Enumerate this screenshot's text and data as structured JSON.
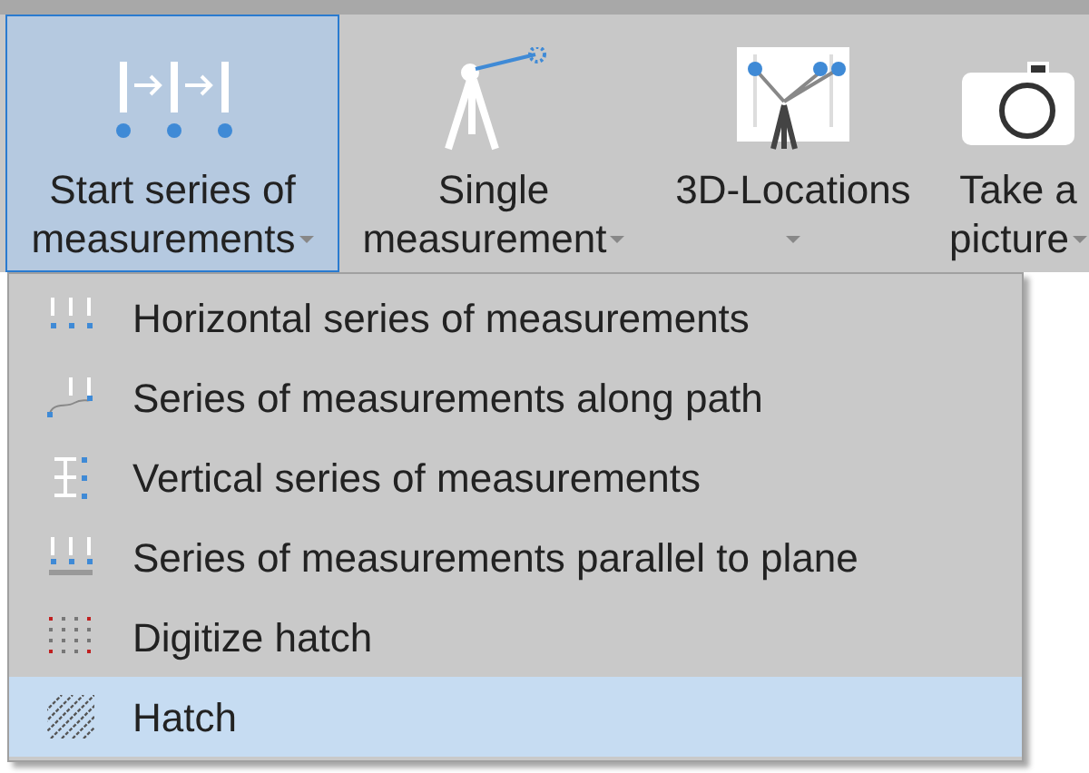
{
  "ribbon": {
    "buttons": [
      {
        "kind": "series",
        "lines": [
          "Start series of",
          "measurements"
        ],
        "dropdown": true,
        "selected": true
      },
      {
        "kind": "single",
        "lines": [
          "Single",
          "measurement"
        ],
        "dropdown": true,
        "selected": false
      },
      {
        "kind": "locations",
        "lines": [
          "3D-Locations"
        ],
        "dropdown": true,
        "selected": false
      },
      {
        "kind": "camera",
        "lines": [
          "Take a",
          "picture"
        ],
        "dropdown": true,
        "selected": false
      }
    ]
  },
  "menu": {
    "items": [
      {
        "kind": "horizontal",
        "label": "Horizontal series of measurements",
        "selected": false
      },
      {
        "kind": "path",
        "label": "Series of measurements along path",
        "selected": false
      },
      {
        "kind": "vertical",
        "label": "Vertical series of measurements",
        "selected": false
      },
      {
        "kind": "plane",
        "label": "Series of measurements parallel to plane",
        "selected": false
      },
      {
        "kind": "digitize",
        "label": "Digitize hatch",
        "selected": false
      },
      {
        "kind": "hatch",
        "label": "Hatch",
        "selected": true
      }
    ]
  }
}
